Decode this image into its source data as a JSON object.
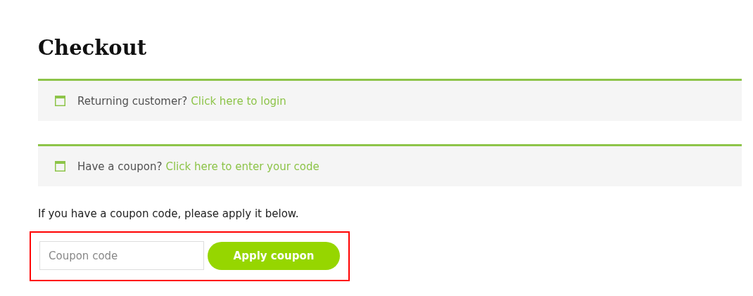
{
  "title": "Checkout",
  "notices": [
    {
      "text": "Returning customer?",
      "link": "Click here to login"
    },
    {
      "text": "Have a coupon?",
      "link": "Click here to enter your code"
    }
  ],
  "coupon_prompt": "If you have a coupon code, please apply it below.",
  "coupon_form": {
    "highlighted": true,
    "placeholder": "Coupon code",
    "button": "Apply coupon"
  }
}
